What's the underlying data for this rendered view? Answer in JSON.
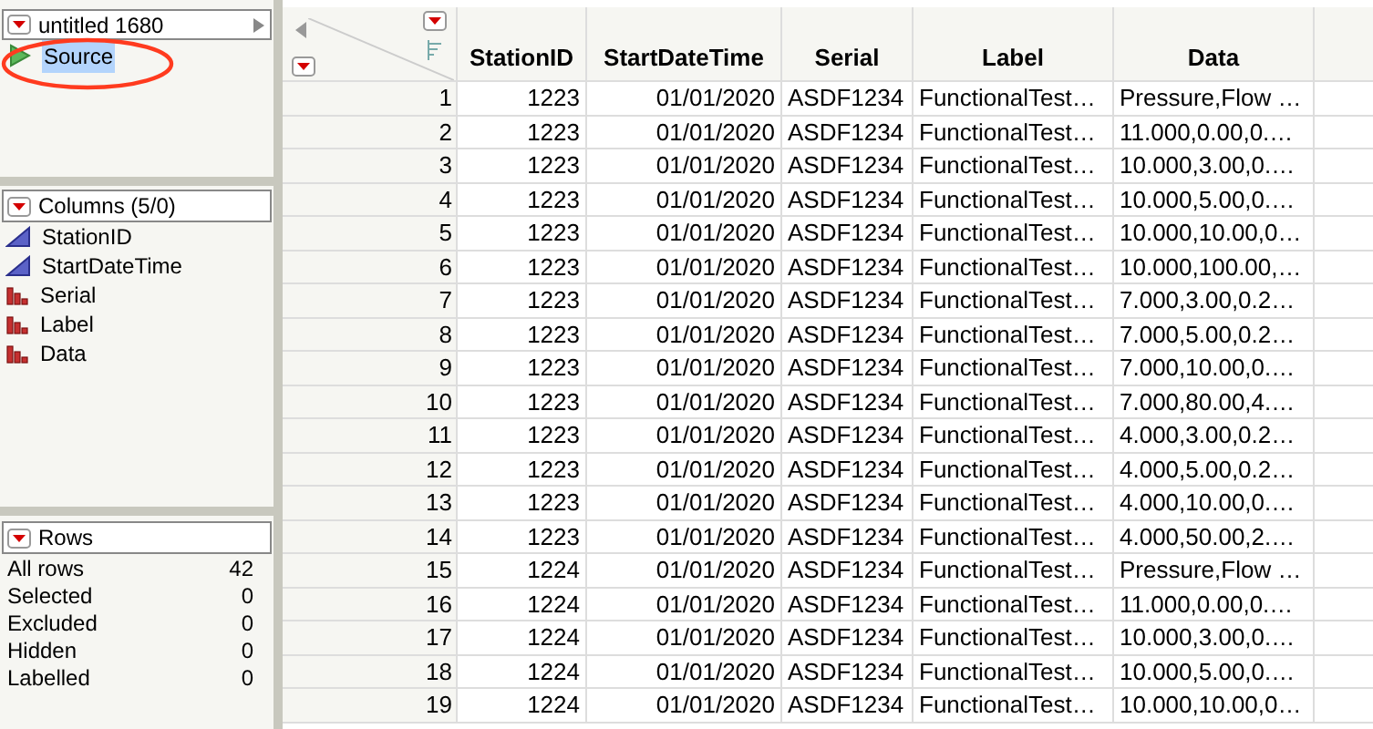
{
  "table_panel": {
    "title": "untitled 1680",
    "scripts": [
      {
        "label": "Source",
        "selected": true
      }
    ]
  },
  "columns_panel": {
    "title": "Columns (5/0)",
    "columns": [
      {
        "name": "StationID",
        "kind": "continuous"
      },
      {
        "name": "StartDateTime",
        "kind": "continuous"
      },
      {
        "name": "Serial",
        "kind": "nominal"
      },
      {
        "name": "Label",
        "kind": "nominal"
      },
      {
        "name": "Data",
        "kind": "nominal"
      }
    ]
  },
  "rows_panel": {
    "title": "Rows",
    "stats": [
      {
        "label": "All rows",
        "value": "42"
      },
      {
        "label": "Selected",
        "value": "0"
      },
      {
        "label": "Excluded",
        "value": "0"
      },
      {
        "label": "Hidden",
        "value": "0"
      },
      {
        "label": "Labelled",
        "value": "0"
      }
    ]
  },
  "table": {
    "columns": [
      "StationID",
      "StartDateTime",
      "Serial",
      "Label",
      "Data"
    ],
    "rows": [
      {
        "n": "1",
        "cells": [
          "1223",
          "01/01/2020",
          "ASDF1234",
          "FunctionalTest…",
          "Pressure,Flow …"
        ]
      },
      {
        "n": "2",
        "cells": [
          "1223",
          "01/01/2020",
          "ASDF1234",
          "FunctionalTest…",
          "11.000,0.00,0.…"
        ]
      },
      {
        "n": "3",
        "cells": [
          "1223",
          "01/01/2020",
          "ASDF1234",
          "FunctionalTest…",
          "10.000,3.00,0.…"
        ]
      },
      {
        "n": "4",
        "cells": [
          "1223",
          "01/01/2020",
          "ASDF1234",
          "FunctionalTest…",
          "10.000,5.00,0.…"
        ]
      },
      {
        "n": "5",
        "cells": [
          "1223",
          "01/01/2020",
          "ASDF1234",
          "FunctionalTest…",
          "10.000,10.00,0…"
        ]
      },
      {
        "n": "6",
        "cells": [
          "1223",
          "01/01/2020",
          "ASDF1234",
          "FunctionalTest…",
          "10.000,100.00,…"
        ]
      },
      {
        "n": "7",
        "cells": [
          "1223",
          "01/01/2020",
          "ASDF1234",
          "FunctionalTest…",
          "7.000,3.00,0.2…"
        ]
      },
      {
        "n": "8",
        "cells": [
          "1223",
          "01/01/2020",
          "ASDF1234",
          "FunctionalTest…",
          "7.000,5.00,0.2…"
        ]
      },
      {
        "n": "9",
        "cells": [
          "1223",
          "01/01/2020",
          "ASDF1234",
          "FunctionalTest…",
          "7.000,10.00,0.…"
        ]
      },
      {
        "n": "10",
        "cells": [
          "1223",
          "01/01/2020",
          "ASDF1234",
          "FunctionalTest…",
          "7.000,80.00,4.…"
        ]
      },
      {
        "n": "11",
        "cells": [
          "1223",
          "01/01/2020",
          "ASDF1234",
          "FunctionalTest…",
          "4.000,3.00,0.2…"
        ]
      },
      {
        "n": "12",
        "cells": [
          "1223",
          "01/01/2020",
          "ASDF1234",
          "FunctionalTest…",
          "4.000,5.00,0.2…"
        ]
      },
      {
        "n": "13",
        "cells": [
          "1223",
          "01/01/2020",
          "ASDF1234",
          "FunctionalTest…",
          "4.000,10.00,0.…"
        ]
      },
      {
        "n": "14",
        "cells": [
          "1223",
          "01/01/2020",
          "ASDF1234",
          "FunctionalTest…",
          "4.000,50.00,2.…"
        ]
      },
      {
        "n": "15",
        "cells": [
          "1224",
          "01/01/2020",
          "ASDF1234",
          "FunctionalTest…",
          "Pressure,Flow …"
        ]
      },
      {
        "n": "16",
        "cells": [
          "1224",
          "01/01/2020",
          "ASDF1234",
          "FunctionalTest…",
          "11.000,0.00,0.…"
        ]
      },
      {
        "n": "17",
        "cells": [
          "1224",
          "01/01/2020",
          "ASDF1234",
          "FunctionalTest…",
          "10.000,3.00,0.…"
        ]
      },
      {
        "n": "18",
        "cells": [
          "1224",
          "01/01/2020",
          "ASDF1234",
          "FunctionalTest…",
          "10.000,5.00,0.…"
        ]
      },
      {
        "n": "19",
        "cells": [
          "1224",
          "01/01/2020",
          "ASDF1234",
          "FunctionalTest…",
          "10.000,10.00,0…"
        ]
      }
    ]
  }
}
